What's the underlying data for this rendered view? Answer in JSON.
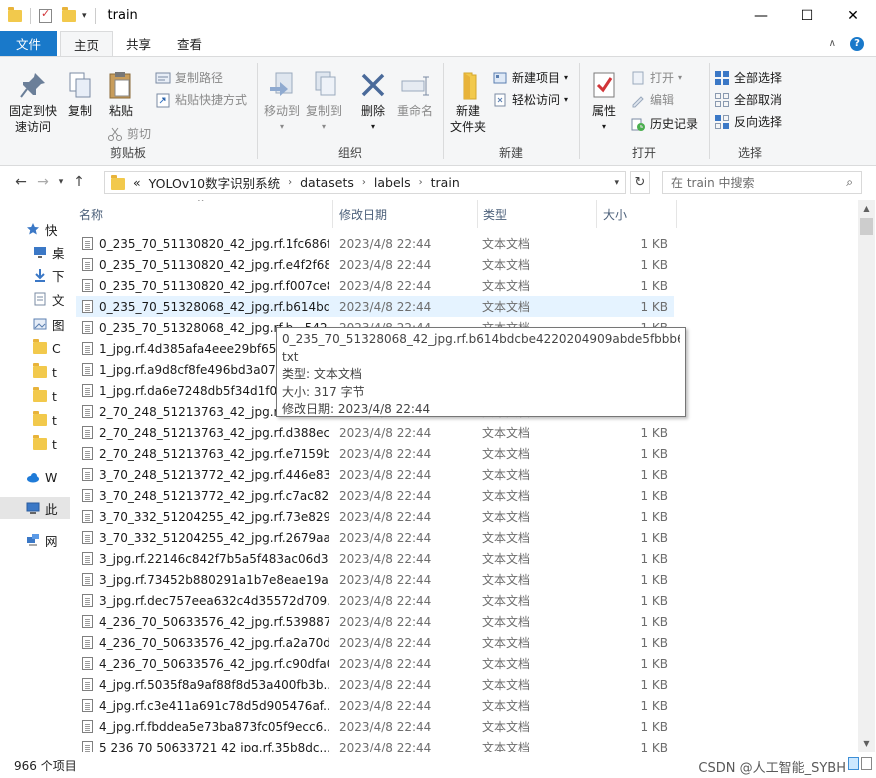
{
  "window": {
    "title": "train",
    "buttons": {
      "minimize": "—",
      "maximize": "☐",
      "close": "✕"
    }
  },
  "ribbon": {
    "tabs": {
      "file": "文件",
      "home": "主页",
      "share": "共享",
      "view": "查看"
    },
    "clipboard": {
      "label": "剪贴板",
      "pin": "固定到快速访问",
      "pin_line1": "固定到快",
      "pin_line2": "速访问",
      "copy": "复制",
      "paste": "粘贴",
      "copy_path": "复制路径",
      "paste_shortcut": "粘贴快捷方式",
      "cut": "剪切"
    },
    "organize": {
      "label": "组织",
      "move_to": "移动到",
      "copy_to": "复制到",
      "delete": "删除",
      "rename": "重命名"
    },
    "new": {
      "label": "新建",
      "new_folder_line1": "新建",
      "new_folder_line2": "文件夹",
      "new_item": "新建项目",
      "easy_access": "轻松访问"
    },
    "open": {
      "label": "打开",
      "properties": "属性",
      "open": "打开",
      "edit": "编辑",
      "history": "历史记录"
    },
    "select": {
      "label": "选择",
      "select_all": "全部选择",
      "select_none": "全部取消",
      "invert": "反向选择"
    }
  },
  "address": {
    "overflow": "«",
    "crumbs": [
      "YOLOv10数字识别系统",
      "datasets",
      "labels",
      "train"
    ],
    "search_placeholder": "在 train 中搜索"
  },
  "nav_pane": {
    "items": [
      {
        "label": "快",
        "icon": "star-icon"
      },
      {
        "label": "桌",
        "icon": "desktop-icon"
      },
      {
        "label": "下",
        "icon": "download-icon"
      },
      {
        "label": "文",
        "icon": "document-icon"
      },
      {
        "label": "图",
        "icon": "picture-icon"
      },
      {
        "label": "C",
        "icon": "folder-icon"
      },
      {
        "label": "t",
        "icon": "folder-icon"
      },
      {
        "label": "t",
        "icon": "folder-icon"
      },
      {
        "label": "t",
        "icon": "folder-icon"
      },
      {
        "label": "t",
        "icon": "folder-icon"
      },
      {
        "label": "W",
        "icon": "cloud-icon"
      },
      {
        "label": "此",
        "icon": "computer-icon"
      },
      {
        "label": "网",
        "icon": "network-icon"
      }
    ]
  },
  "columns": {
    "name": "名称",
    "date": "修改日期",
    "type": "类型",
    "size": "大小"
  },
  "files": [
    {
      "name": "0_235_70_51130820_42_jpg.rf.1fc686f...",
      "date": "2023/4/8 22:44",
      "type": "文本文档",
      "size": "1 KB"
    },
    {
      "name": "0_235_70_51130820_42_jpg.rf.e4f2f68...",
      "date": "2023/4/8 22:44",
      "type": "文本文档",
      "size": "1 KB"
    },
    {
      "name": "0_235_70_51130820_42_jpg.rf.f007ce8...",
      "date": "2023/4/8 22:44",
      "type": "文本文档",
      "size": "1 KB"
    },
    {
      "name": "0_235_70_51328068_42_jpg.rf.b614bd...",
      "date": "2023/4/8 22:44",
      "type": "文本文档",
      "size": "1 KB"
    },
    {
      "name": "0_235_70_51328068_42_jpg.rf.b...5424...",
      "date": "2023/4/8 22:44",
      "type": "文本文档",
      "size": "1 KB"
    },
    {
      "name": "1_jpg.rf.4d385afa4eee29bf65e...",
      "date": "2023/4/8 22:44",
      "type": "文本文档",
      "size": "1 KB"
    },
    {
      "name": "1_jpg.rf.a9d8cf8fe496bd3a07d...",
      "date": "2023/4/8 22:44",
      "type": "文本文档",
      "size": "1 KB"
    },
    {
      "name": "1_jpg.rf.da6e7248db5f34d1f08...",
      "date": "2023/4/8 22:44",
      "type": "文本文档",
      "size": "1 KB"
    },
    {
      "name": "2_70_248_51213763_42_jpg.rf.8...",
      "date": "2023/4/8 22:44",
      "type": "文本文档",
      "size": "1 KB"
    },
    {
      "name": "2_70_248_51213763_42_jpg.rf.d388ec...",
      "date": "2023/4/8 22:44",
      "type": "文本文档",
      "size": "1 KB"
    },
    {
      "name": "2_70_248_51213763_42_jpg.rf.e7159b...",
      "date": "2023/4/8 22:44",
      "type": "文本文档",
      "size": "1 KB"
    },
    {
      "name": "3_70_248_51213772_42_jpg.rf.446e83...",
      "date": "2023/4/8 22:44",
      "type": "文本文档",
      "size": "1 KB"
    },
    {
      "name": "3_70_248_51213772_42_jpg.rf.c7ac82...",
      "date": "2023/4/8 22:44",
      "type": "文本文档",
      "size": "1 KB"
    },
    {
      "name": "3_70_332_51204255_42_jpg.rf.73e829...",
      "date": "2023/4/8 22:44",
      "type": "文本文档",
      "size": "1 KB"
    },
    {
      "name": "3_70_332_51204255_42_jpg.rf.2679aa...",
      "date": "2023/4/8 22:44",
      "type": "文本文档",
      "size": "1 KB"
    },
    {
      "name": "3_jpg.rf.22146c842f7b5a5f483ac06d3...",
      "date": "2023/4/8 22:44",
      "type": "文本文档",
      "size": "1 KB"
    },
    {
      "name": "3_jpg.rf.73452b880291a1b7e8eae19a...",
      "date": "2023/4/8 22:44",
      "type": "文本文档",
      "size": "1 KB"
    },
    {
      "name": "3_jpg.rf.dec757eea632c4d35572d709...",
      "date": "2023/4/8 22:44",
      "type": "文本文档",
      "size": "1 KB"
    },
    {
      "name": "4_236_70_50633576_42_jpg.rf.539887...",
      "date": "2023/4/8 22:44",
      "type": "文本文档",
      "size": "1 KB"
    },
    {
      "name": "4_236_70_50633576_42_jpg.rf.a2a70d...",
      "date": "2023/4/8 22:44",
      "type": "文本文档",
      "size": "1 KB"
    },
    {
      "name": "4_236_70_50633576_42_jpg.rf.c90dfa0...",
      "date": "2023/4/8 22:44",
      "type": "文本文档",
      "size": "1 KB"
    },
    {
      "name": "4_jpg.rf.5035f8a9af88f8d53a400fb3b...",
      "date": "2023/4/8 22:44",
      "type": "文本文档",
      "size": "1 KB"
    },
    {
      "name": "4_jpg.rf.c3e411a691c78d5d905476af...",
      "date": "2023/4/8 22:44",
      "type": "文本文档",
      "size": "1 KB"
    },
    {
      "name": "4_jpg.rf.fbddea5e73ba873fc05f9ecc6...",
      "date": "2023/4/8 22:44",
      "type": "文本文档",
      "size": "1 KB"
    },
    {
      "name": "5 236 70 50633721 42 jpg.rf.35b8dc...",
      "date": "2023/4/8 22:44",
      "type": "文本文档",
      "size": "1 KB"
    }
  ],
  "tooltip": {
    "filename_line1": "0_235_70_51328068_42_jpg.rf.b614bdcbe4220204909abde5fbbb6fc7.",
    "filename_line2": "txt",
    "type": "类型: 文本文档",
    "size": "大小: 317 字节",
    "modified": "修改日期: 2023/4/8 22:44"
  },
  "status": {
    "count": "966 个项目",
    "watermark": "CSDN @人工智能_SYBH"
  },
  "colors": {
    "accent": "#1979ca",
    "ribbon_bg": "#f5f6f7",
    "hover_row": "#e5f3ff",
    "folder": "#f2c94c"
  }
}
